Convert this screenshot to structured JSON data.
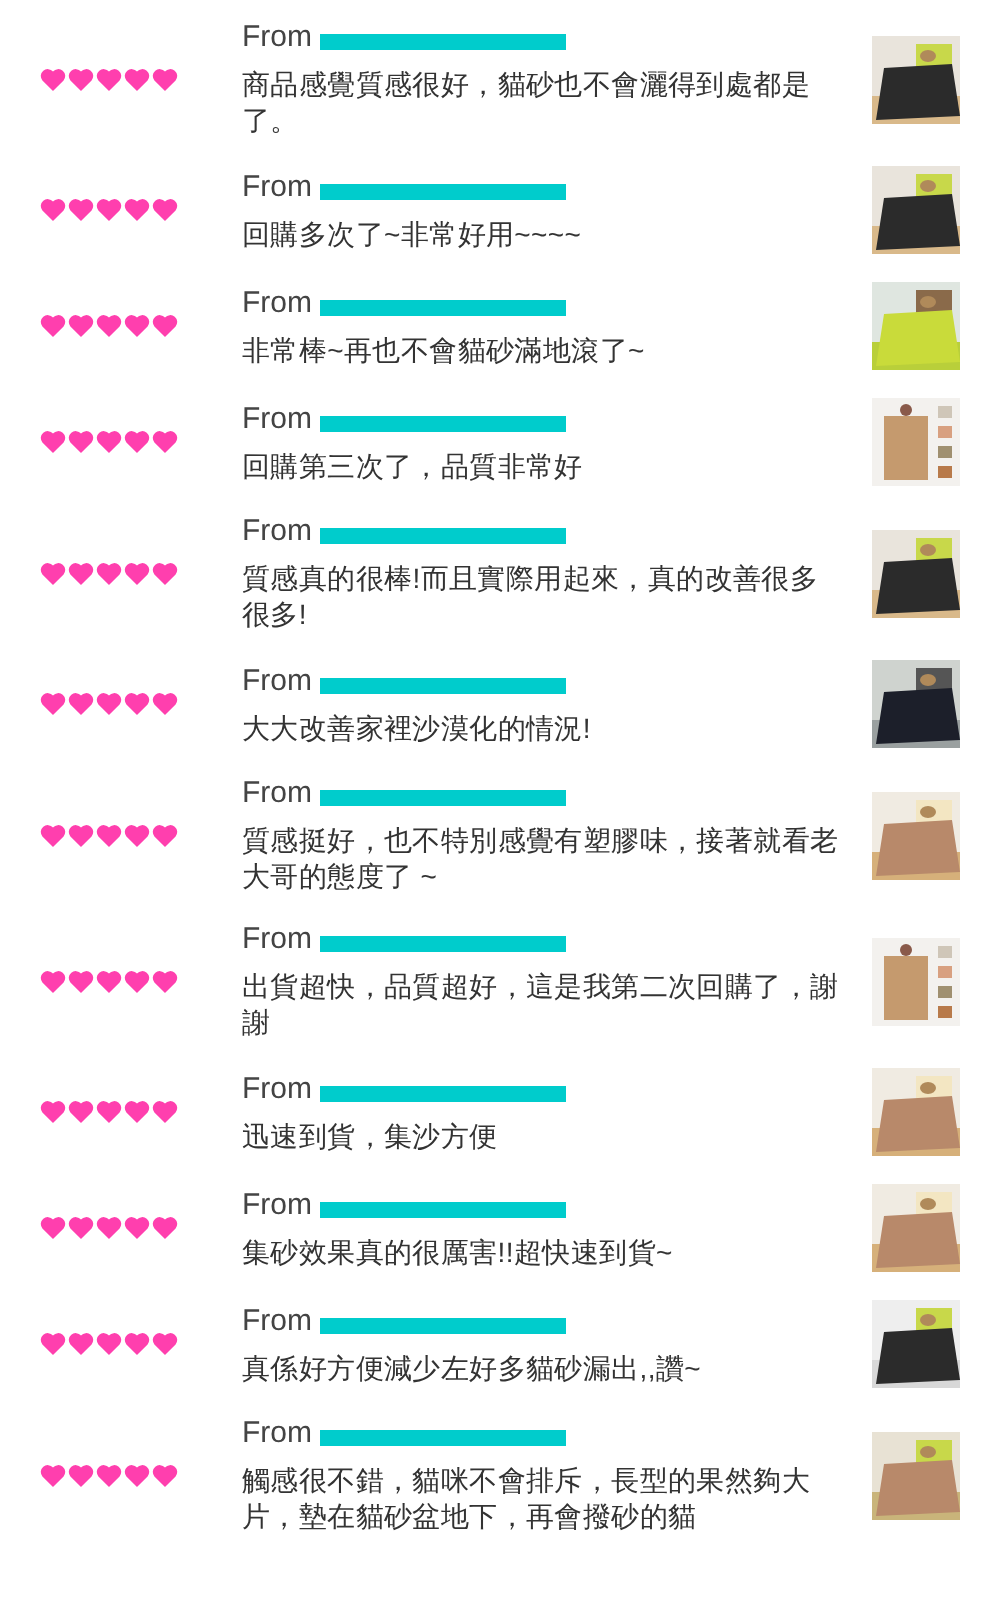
{
  "reviews": [
    {
      "from": "From",
      "stars": 5,
      "text": "商品感覺質感很好，貓砂也不會灑得到處都是了。"
    },
    {
      "from": "From",
      "stars": 5,
      "text": "回購多次了~非常好用~~~~"
    },
    {
      "from": "From",
      "stars": 5,
      "text": "非常棒~再也不會貓砂滿地滾了~"
    },
    {
      "from": "From",
      "stars": 5,
      "text": "回購第三次了，品質非常好"
    },
    {
      "from": "From",
      "stars": 5,
      "text": "質感真的很棒!而且實際用起來，真的改善很多很多!"
    },
    {
      "from": "From",
      "stars": 5,
      "text": "大大改善家裡沙漠化的情況!"
    },
    {
      "from": "From",
      "stars": 5,
      "text": "質感挺好，也不特別感覺有塑膠味，接著就看老大哥的態度了 ~"
    },
    {
      "from": "From",
      "stars": 5,
      "text": "出貨超快，品質超好，這是我第二次回購了，謝謝"
    },
    {
      "from": "From",
      "stars": 5,
      "text": "迅速到貨，集沙方便"
    },
    {
      "from": "From",
      "stars": 5,
      "text": "集砂效果真的很厲害!!超快速到貨~"
    },
    {
      "from": "From",
      "stars": 5,
      "text": "真係好方便減少左好多貓砂漏出,,讚~"
    },
    {
      "from": "From",
      "stars": 5,
      "text": "觸感很不錯，貓咪不會排斥，長型的果然夠大片，墊在貓砂盆地下，再會撥砂的貓"
    }
  ]
}
